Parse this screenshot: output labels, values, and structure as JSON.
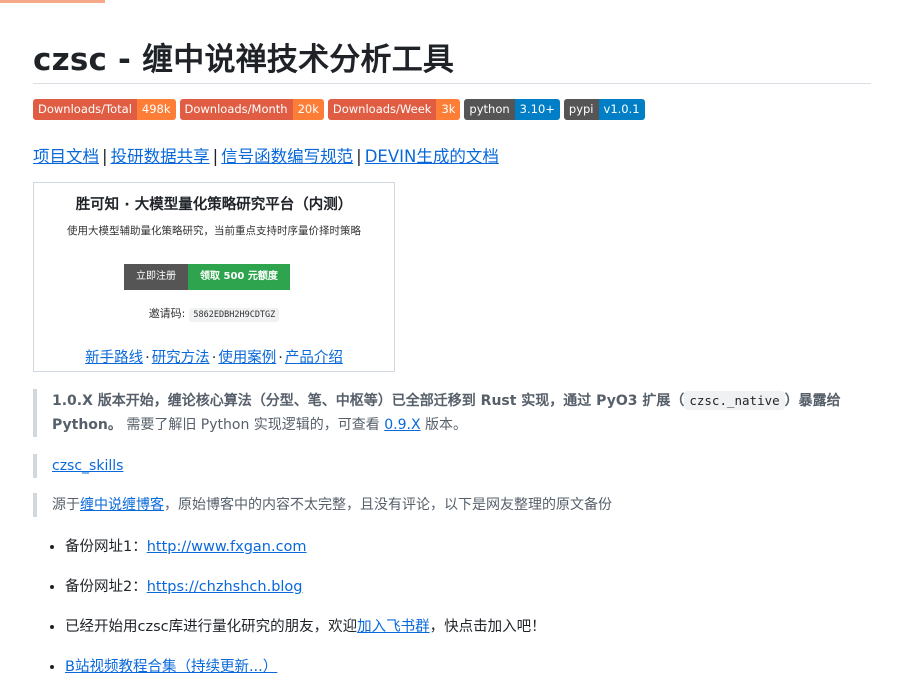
{
  "title": {
    "prefix": "czsc - ",
    "main": "缠中说禅技术分析工具"
  },
  "badges": [
    {
      "label": "Downloads/Total",
      "value": "498k",
      "style": "orange"
    },
    {
      "label": "Downloads/Month",
      "value": "20k",
      "style": "orange"
    },
    {
      "label": "Downloads/Week",
      "value": "3k",
      "style": "orange"
    },
    {
      "label": "python",
      "value": "3.10+",
      "style": "dark"
    },
    {
      "label": "pypi",
      "value": "v1.0.1",
      "style": "dark"
    }
  ],
  "doc_links": [
    "项目文档",
    "投研数据共享",
    "信号函数编写规范",
    "DEVIN生成的文档"
  ],
  "doc_link_separator": "|",
  "card": {
    "title": "胜可知 · 大模型量化策略研究平台（内测）",
    "subtitle": "使用大模型辅助量化策略研究，当前重点支持时序量价择时策略",
    "register_label": "立即注册",
    "claim_label": "领取 500 元额度",
    "invite_label": "邀请码:",
    "invite_code": "5862EDBH2H9CDTGZ",
    "links": [
      "新手路线",
      "研究方法",
      "使用案例",
      "产品介绍"
    ],
    "link_separator": "·"
  },
  "notice": {
    "bold_prefix": "1.0.X 版本开始，缠论核心算法（分型、笔、中枢等）已全部迁移到 Rust 实现，通过 PyO3 扩展（",
    "code": "czsc._native",
    "bold_suffix": "）暴露给 Python。",
    "text": " 需要了解旧 Python 实现逻辑的，可查看 ",
    "version_link": "0.9.X",
    "tail": " 版本。"
  },
  "skills_link": "czsc_skills",
  "source_quote": {
    "prefix": "源于",
    "link": "缠中说缠博客",
    "suffix": "，原始博客中的内容不太完整，且没有评论，以下是网友整理的原文备份"
  },
  "list_items": [
    {
      "prefix": "备份网址1：",
      "link": "http://www.fxgan.com",
      "suffix": ""
    },
    {
      "prefix": "备份网址2：",
      "link": "https://chzhshch.blog",
      "suffix": ""
    },
    {
      "prefix": "已经开始用czsc库进行量化研究的朋友，欢迎",
      "link": "加入飞书群",
      "suffix": "，快点击加入吧！"
    },
    {
      "prefix": "",
      "link": "B站视频教程合集（持续更新...）",
      "suffix": ""
    }
  ],
  "colors": {
    "link": "#0969da",
    "badge_orange_left": "#e05d44",
    "badge_orange_right": "#fe7d37",
    "badge_dark_left": "#555555",
    "badge_dark_right": "#007ec6",
    "claim_green": "#2ea44f"
  }
}
